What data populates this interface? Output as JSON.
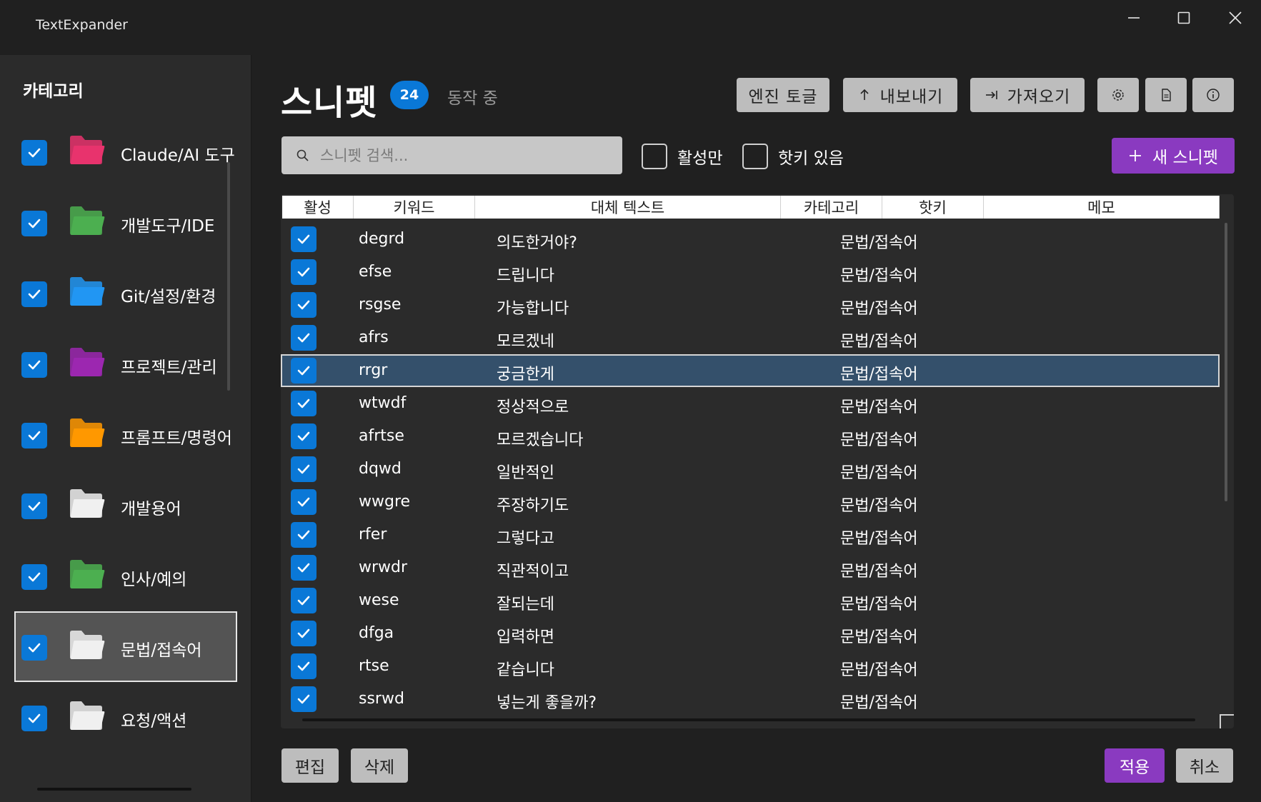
{
  "window": {
    "title": "TextExpander"
  },
  "sidebar": {
    "heading": "카테고리",
    "categories": [
      {
        "label": "Claude/AI 도구",
        "checked": true,
        "color": "#e8336d"
      },
      {
        "label": "개발도구/IDE",
        "checked": true,
        "color": "#4caf50"
      },
      {
        "label": "Git/설정/환경",
        "checked": true,
        "color": "#2196f3"
      },
      {
        "label": "프로젝트/관리",
        "checked": true,
        "color": "#9c27b0"
      },
      {
        "label": "프롬프트/명령어",
        "checked": true,
        "color": "#ff9800"
      },
      {
        "label": "개발용어",
        "checked": true,
        "color": "#f0f0f0"
      },
      {
        "label": "인사/예의",
        "checked": true,
        "color": "#4caf50"
      },
      {
        "label": "문법/접속어",
        "checked": true,
        "color": "#f0f0f0",
        "selected": true
      },
      {
        "label": "요청/액션",
        "checked": true,
        "color": "#f0f0f0"
      }
    ],
    "buttons": {
      "add_icon": "plus-icon",
      "edit_icon": "pencil-icon",
      "delete_icon": "trash-icon"
    }
  },
  "header": {
    "title": "스니펫",
    "count": "24",
    "status": "동작 중",
    "engine_toggle_label": "엔진 토글",
    "export_label": "내보내기",
    "import_label": "가져오기",
    "settings_icon": "gear-icon",
    "document_icon": "document-icon",
    "info_icon": "info-icon"
  },
  "filters": {
    "search_placeholder": "스니펫 검색...",
    "active_only_label": "활성만",
    "has_hotkey_label": "핫키 있음",
    "new_snippet_label": "새 스니펫"
  },
  "table": {
    "columns": [
      "활성",
      "키워드",
      "대체 텍스트",
      "카테고리",
      "핫키",
      "메모"
    ],
    "rows": [
      {
        "active": true,
        "keyword": "degrd",
        "replacement": "의도한거야?",
        "category": "문법/접속어",
        "hotkey": "",
        "memo": ""
      },
      {
        "active": true,
        "keyword": "efse",
        "replacement": "드립니다",
        "category": "문법/접속어",
        "hotkey": "",
        "memo": ""
      },
      {
        "active": true,
        "keyword": "rsgse",
        "replacement": "가능합니다",
        "category": "문법/접속어",
        "hotkey": "",
        "memo": ""
      },
      {
        "active": true,
        "keyword": "afrs",
        "replacement": "모르겠네",
        "category": "문법/접속어",
        "hotkey": "",
        "memo": ""
      },
      {
        "active": true,
        "keyword": "rrgr",
        "replacement": "궁금한게",
        "category": "문법/접속어",
        "hotkey": "",
        "memo": "",
        "selected": true
      },
      {
        "active": true,
        "keyword": "wtwdf",
        "replacement": "정상적으로",
        "category": "문법/접속어",
        "hotkey": "",
        "memo": ""
      },
      {
        "active": true,
        "keyword": "afrtse",
        "replacement": "모르겠습니다",
        "category": "문법/접속어",
        "hotkey": "",
        "memo": ""
      },
      {
        "active": true,
        "keyword": "dqwd",
        "replacement": "일반적인",
        "category": "문법/접속어",
        "hotkey": "",
        "memo": ""
      },
      {
        "active": true,
        "keyword": "wwgre",
        "replacement": "주장하기도",
        "category": "문법/접속어",
        "hotkey": "",
        "memo": ""
      },
      {
        "active": true,
        "keyword": "rfer",
        "replacement": "그렇다고",
        "category": "문법/접속어",
        "hotkey": "",
        "memo": ""
      },
      {
        "active": true,
        "keyword": "wrwdr",
        "replacement": "직관적이고",
        "category": "문법/접속어",
        "hotkey": "",
        "memo": ""
      },
      {
        "active": true,
        "keyword": "wese",
        "replacement": "잘되는데",
        "category": "문법/접속어",
        "hotkey": "",
        "memo": ""
      },
      {
        "active": true,
        "keyword": "dfga",
        "replacement": "입력하면",
        "category": "문법/접속어",
        "hotkey": "",
        "memo": ""
      },
      {
        "active": true,
        "keyword": "rtse",
        "replacement": "같습니다",
        "category": "문법/접속어",
        "hotkey": "",
        "memo": ""
      },
      {
        "active": true,
        "keyword": "ssrwd",
        "replacement": "넣는게 좋을까?",
        "category": "문법/접속어",
        "hotkey": "",
        "memo": ""
      }
    ]
  },
  "footer": {
    "edit_label": "편집",
    "delete_label": "삭제",
    "apply_label": "적용",
    "cancel_label": "취소"
  },
  "colors": {
    "accent_blue": "#0a78d7",
    "accent_purple": "#8a3ac0",
    "selected_row": "#34506b"
  }
}
